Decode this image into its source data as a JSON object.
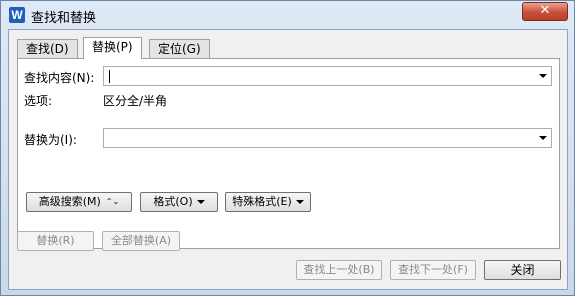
{
  "window": {
    "title": "查找和替换",
    "app_icon": "W",
    "close_glyph": "✕"
  },
  "tabs": [
    {
      "label": "查找(D)",
      "active": false
    },
    {
      "label": "替换(P)",
      "active": true
    },
    {
      "label": "定位(G)",
      "active": false
    }
  ],
  "find": {
    "label": "查找内容(N):",
    "value": ""
  },
  "options": {
    "label": "选项:",
    "value": "区分全/半角"
  },
  "replace": {
    "label": "替换为(I):",
    "value": ""
  },
  "panel_buttons": {
    "advanced_search": "高级搜索(M)",
    "advanced_glyph": "⌃⌄",
    "format": "格式(O)",
    "special_format": "特殊格式(E)"
  },
  "action_buttons": {
    "replace": "替换(R)",
    "replace_all": "全部替换(A)",
    "find_prev": "查找上一处(B)",
    "find_next": "查找下一处(F)",
    "close": "关闭"
  }
}
